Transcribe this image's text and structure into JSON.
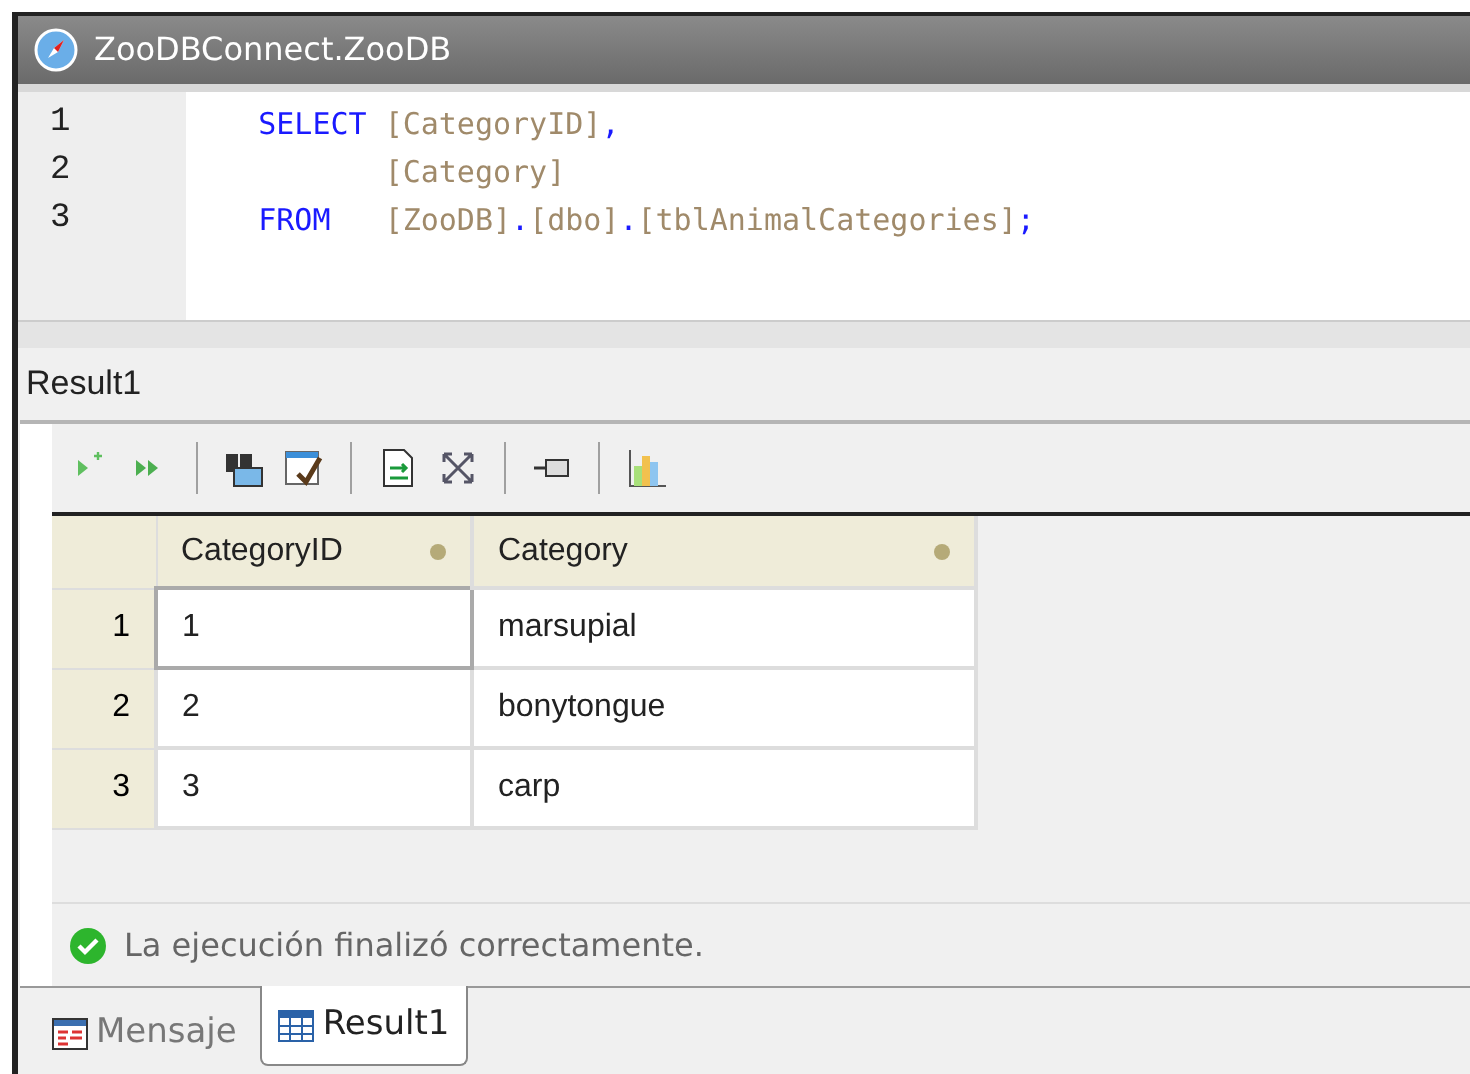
{
  "window": {
    "title": "ZooDBConnect.ZooDB"
  },
  "code_lines": [
    {
      "number": "1",
      "tokens": [
        {
          "kind": "keyword",
          "text": "SELECT"
        },
        {
          "kind": "ident",
          "text": "[CategoryID]"
        },
        {
          "kind": "punct",
          "text": ","
        }
      ]
    },
    {
      "number": "2",
      "tokens": [
        {
          "kind": "ident",
          "text": "[Category]"
        }
      ]
    },
    {
      "number": "3",
      "tokens": [
        {
          "kind": "keyword",
          "text": "FROM"
        },
        {
          "kind": "ident",
          "text": "[ZooDB]"
        },
        {
          "kind": "punct",
          "text": "."
        },
        {
          "kind": "ident",
          "text": "[dbo]"
        },
        {
          "kind": "punct",
          "text": "."
        },
        {
          "kind": "ident",
          "text": "[tblAnimalCategories]"
        },
        {
          "kind": "punct",
          "text": ";"
        }
      ]
    }
  ],
  "result_title": "Result1",
  "toolbar": [
    {
      "kind": "append-row"
    },
    {
      "kind": "fast-forward"
    },
    {
      "kind": "sep"
    },
    {
      "kind": "find"
    },
    {
      "kind": "check"
    },
    {
      "kind": "sep"
    },
    {
      "kind": "export"
    },
    {
      "kind": "expand"
    },
    {
      "kind": "sep"
    },
    {
      "kind": "pin"
    },
    {
      "kind": "sep"
    },
    {
      "kind": "chart"
    }
  ],
  "table": {
    "columns": [
      "CategoryID",
      "Category"
    ],
    "rows": [
      {
        "number": "1",
        "cells": [
          "1",
          "marsupial"
        ],
        "focused": true
      },
      {
        "number": "2",
        "cells": [
          "2",
          "bonytongue"
        ],
        "focused": false
      },
      {
        "number": "3",
        "cells": [
          "3",
          "carp"
        ],
        "focused": false
      }
    ]
  },
  "status": "La ejecución finalizó correctamente.",
  "tabs": [
    {
      "label": "Mensaje",
      "kind": "message",
      "selected": false
    },
    {
      "label": "Result1",
      "kind": "grid",
      "selected": true
    }
  ]
}
